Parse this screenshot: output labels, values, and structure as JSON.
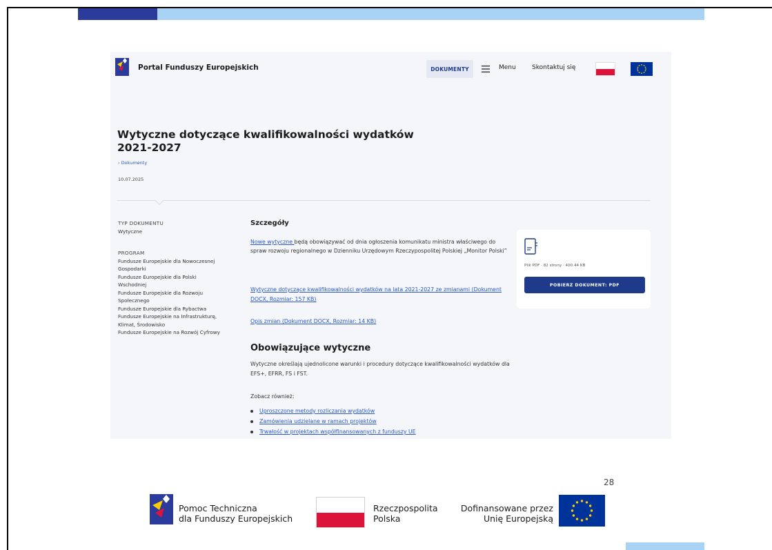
{
  "colors": {
    "bar_dark": "#2b3b9c",
    "bar_light": "#a9d3f5",
    "portal_bg": "#f4f6fa",
    "link": "#2a57c9",
    "primary_button": "#1f3a8a",
    "pl_red": "#dc143c",
    "eu_blue": "#003399",
    "eu_star": "#ffcc00"
  },
  "portal": {
    "brand": "Portal Funduszy Europejskich",
    "nav": {
      "dokumenty_label": "DOKUMENTY",
      "menu_label": "Menu",
      "contact_label": "Skontaktuj się"
    },
    "title": "Wytyczne dotyczące kwalifikowalności wydatków 2021-2027",
    "breadcrumb": "› Dokumenty",
    "date": "10.07.2025",
    "sidebar": {
      "type_label": "TYP DOKUMENTU",
      "type_value": "Wytyczne",
      "program_label": "PROGRAM",
      "programs": [
        "Fundusze Europejskie dla Nowoczesnej Gospodarki",
        "Fundusze Europejskie dla Polski Wschodniej",
        "Fundusze Europejskie dla Rozwoju Społecznego",
        "Fundusze Europejskie dla Rybactwa",
        "Fundusze Europejskie na Infrastrukturę, Klimat, Środowisko",
        "Fundusze Europejskie na Rozwój Cyfrowy"
      ]
    },
    "details": {
      "heading": "Szczegóły",
      "intro_link": "Nowe wytyczne ",
      "intro_text": "będą obowiązywać od dnia ogłoszenia komunikatu ministra właściwego do spraw rozwoju regionalnego w Dzienniku Urzędowym Rzeczypospolitej Polskiej „Monitor Polski”",
      "doc_link": "Wytyczne dotyczące kwalifikowalności wydatków na lata 2021-2027 ze zmianami (Dokument DOCX, Rozmiar: 157 KB)",
      "changes_link": "Opis zmian (Dokument DOCX, Rozmiar: 14 KB)"
    },
    "file_card": {
      "info": "Plik PDF · 82 strony · 400.44 KB",
      "button": "POBIERZ DOKUMENT: PDF"
    },
    "current": {
      "heading": "Obowiązujące wytyczne",
      "text": "Wytyczne określają ujednolicone warunki i procedury dotyczące kwalifikowalności wydatków dla EFS+, EFRR, FS i FST.",
      "see_also": "Zobacz również:",
      "links": [
        "Uproszczone metody rozliczania wydatków",
        "Zamówienia udzielane w ramach projektów",
        "Trwałość w projektach współfinansowanych z funduszy UE"
      ]
    }
  },
  "page_number": "28",
  "footer": {
    "pt_line1": "Pomoc Techniczna",
    "pt_line2": "dla Funduszy Europejskich",
    "rp_line1": "Rzeczpospolita",
    "rp_line2": "Polska",
    "dof_line1": "Dofinansowane przez",
    "dof_line2": "Unię Europejską"
  }
}
